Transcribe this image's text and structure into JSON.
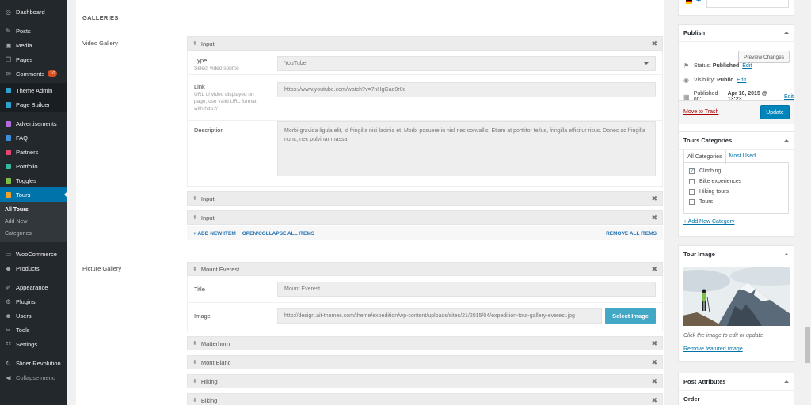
{
  "sidebar": {
    "items": [
      {
        "label": "Dashboard",
        "icon": "dashboard-icon",
        "glyph": "◎"
      },
      {
        "label": "Posts",
        "icon": "pin-icon",
        "glyph": "✎"
      },
      {
        "label": "Media",
        "icon": "media-icon",
        "glyph": "▣"
      },
      {
        "label": "Pages",
        "icon": "pages-icon",
        "glyph": "❐"
      },
      {
        "label": "Comments",
        "icon": "comments-icon",
        "glyph": "✉",
        "badge": "10"
      },
      {
        "label": "Theme Admin",
        "icon": "theme-admin-icon",
        "color": "#2ea2cc"
      },
      {
        "label": "Page Builder",
        "icon": "page-builder-icon",
        "color": "#2ea2cc"
      },
      {
        "label": "Advertisements",
        "icon": "advertisements-icon",
        "color": "#b16ad8"
      },
      {
        "label": "FAQ",
        "icon": "faq-icon",
        "color": "#3b8fd9"
      },
      {
        "label": "Partners",
        "icon": "partners-icon",
        "color": "#e5466f"
      },
      {
        "label": "Portfolio",
        "icon": "portfolio-icon",
        "color": "#36b5a0"
      },
      {
        "label": "Toggles",
        "icon": "toggles-icon",
        "color": "#7cbe42"
      },
      {
        "label": "Tours",
        "icon": "tours-icon",
        "color": "#f0a22a"
      },
      {
        "label": "WooCommerce",
        "icon": "woocommerce-icon",
        "glyph": "▭"
      },
      {
        "label": "Products",
        "icon": "products-icon",
        "glyph": "◆"
      },
      {
        "label": "Appearance",
        "icon": "appearance-icon",
        "glyph": "✐"
      },
      {
        "label": "Plugins",
        "icon": "plugins-icon",
        "glyph": "⚙"
      },
      {
        "label": "Users",
        "icon": "users-icon",
        "glyph": "☻"
      },
      {
        "label": "Tools",
        "icon": "tools-icon",
        "glyph": "✂"
      },
      {
        "label": "Settings",
        "icon": "settings-icon",
        "glyph": "☷"
      },
      {
        "label": "Slider Revolution",
        "icon": "slider-revolution-icon",
        "glyph": "↻"
      },
      {
        "label": "Collapse menu",
        "icon": "collapse-icon",
        "glyph": "◀"
      }
    ],
    "submenu": [
      "All Tours",
      "Add New",
      "Categories"
    ]
  },
  "main": {
    "section_title": "GALLERIES",
    "video_gallery_label": "Video Gallery",
    "video_items": [
      "Input",
      "Input",
      "Input"
    ],
    "video_fields": {
      "type_label": "Type",
      "type_hint": "Select video source",
      "type_value": "YouTube",
      "link_label": "Link",
      "link_hint": "URL of video displayed on page, use valid URL format with http://",
      "link_value": "https://www.youtube.com/watch?v=7nHgGaq9r0c",
      "description_label": "Description",
      "description_value": "Morbi gravida ligula elit, id fringilla nisi lacinia et. Morbi posuere in nisl nec convallis. Etiam at porttitor tellus, fringilla efficitur risus. Donec ac fringilla nunc, nec pulvinar massa."
    },
    "add_new_item": "+ ADD NEW ITEM",
    "open_collapse": "OPEN/COLLAPSE ALL ITEMS",
    "remove_all": "REMOVE ALL ITEMS",
    "picture_gallery_label": "Picture Gallery",
    "picture_items": [
      "Mount Everest",
      "Matterhorn",
      "Mont Blanc",
      "Hiking",
      "Biking"
    ],
    "picture_fields": {
      "title_label": "Title",
      "title_value": "Mount Everest",
      "image_label": "Image",
      "image_value": "http://design.ait-themes.com/theme/expedition/wp-content/uploads/sites/21/2015/04/expedition-tour-gallery-everest.jpg",
      "select_image": "Select Image"
    }
  },
  "publish": {
    "title": "Publish",
    "preview_button": "Preview Changes",
    "status_label": "Status:",
    "status_value": "Published",
    "visibility_label": "Visibility:",
    "visibility_value": "Public",
    "published_label": "Published on:",
    "published_value": "Apr 16, 2015 @ 13:23",
    "edit": "Edit",
    "move_to_trash": "Move to Trash",
    "update_button": "Update"
  },
  "tour_categories": {
    "title": "Tours Categories",
    "tab_all": "All Categories",
    "tab_used": "Most Used",
    "items": [
      {
        "label": "Climbing",
        "checked": true
      },
      {
        "label": "Bike experiences",
        "checked": false
      },
      {
        "label": "Hiking tours",
        "checked": false
      },
      {
        "label": "Tours",
        "checked": false
      }
    ],
    "add_new": "+ Add New Category"
  },
  "tour_image": {
    "title": "Tour Image",
    "hint": "Click the image to edit or update",
    "remove": "Remove featured image"
  },
  "post_attributes": {
    "title": "Post Attributes",
    "order_label": "Order"
  },
  "top_right": {
    "plus": "+"
  }
}
